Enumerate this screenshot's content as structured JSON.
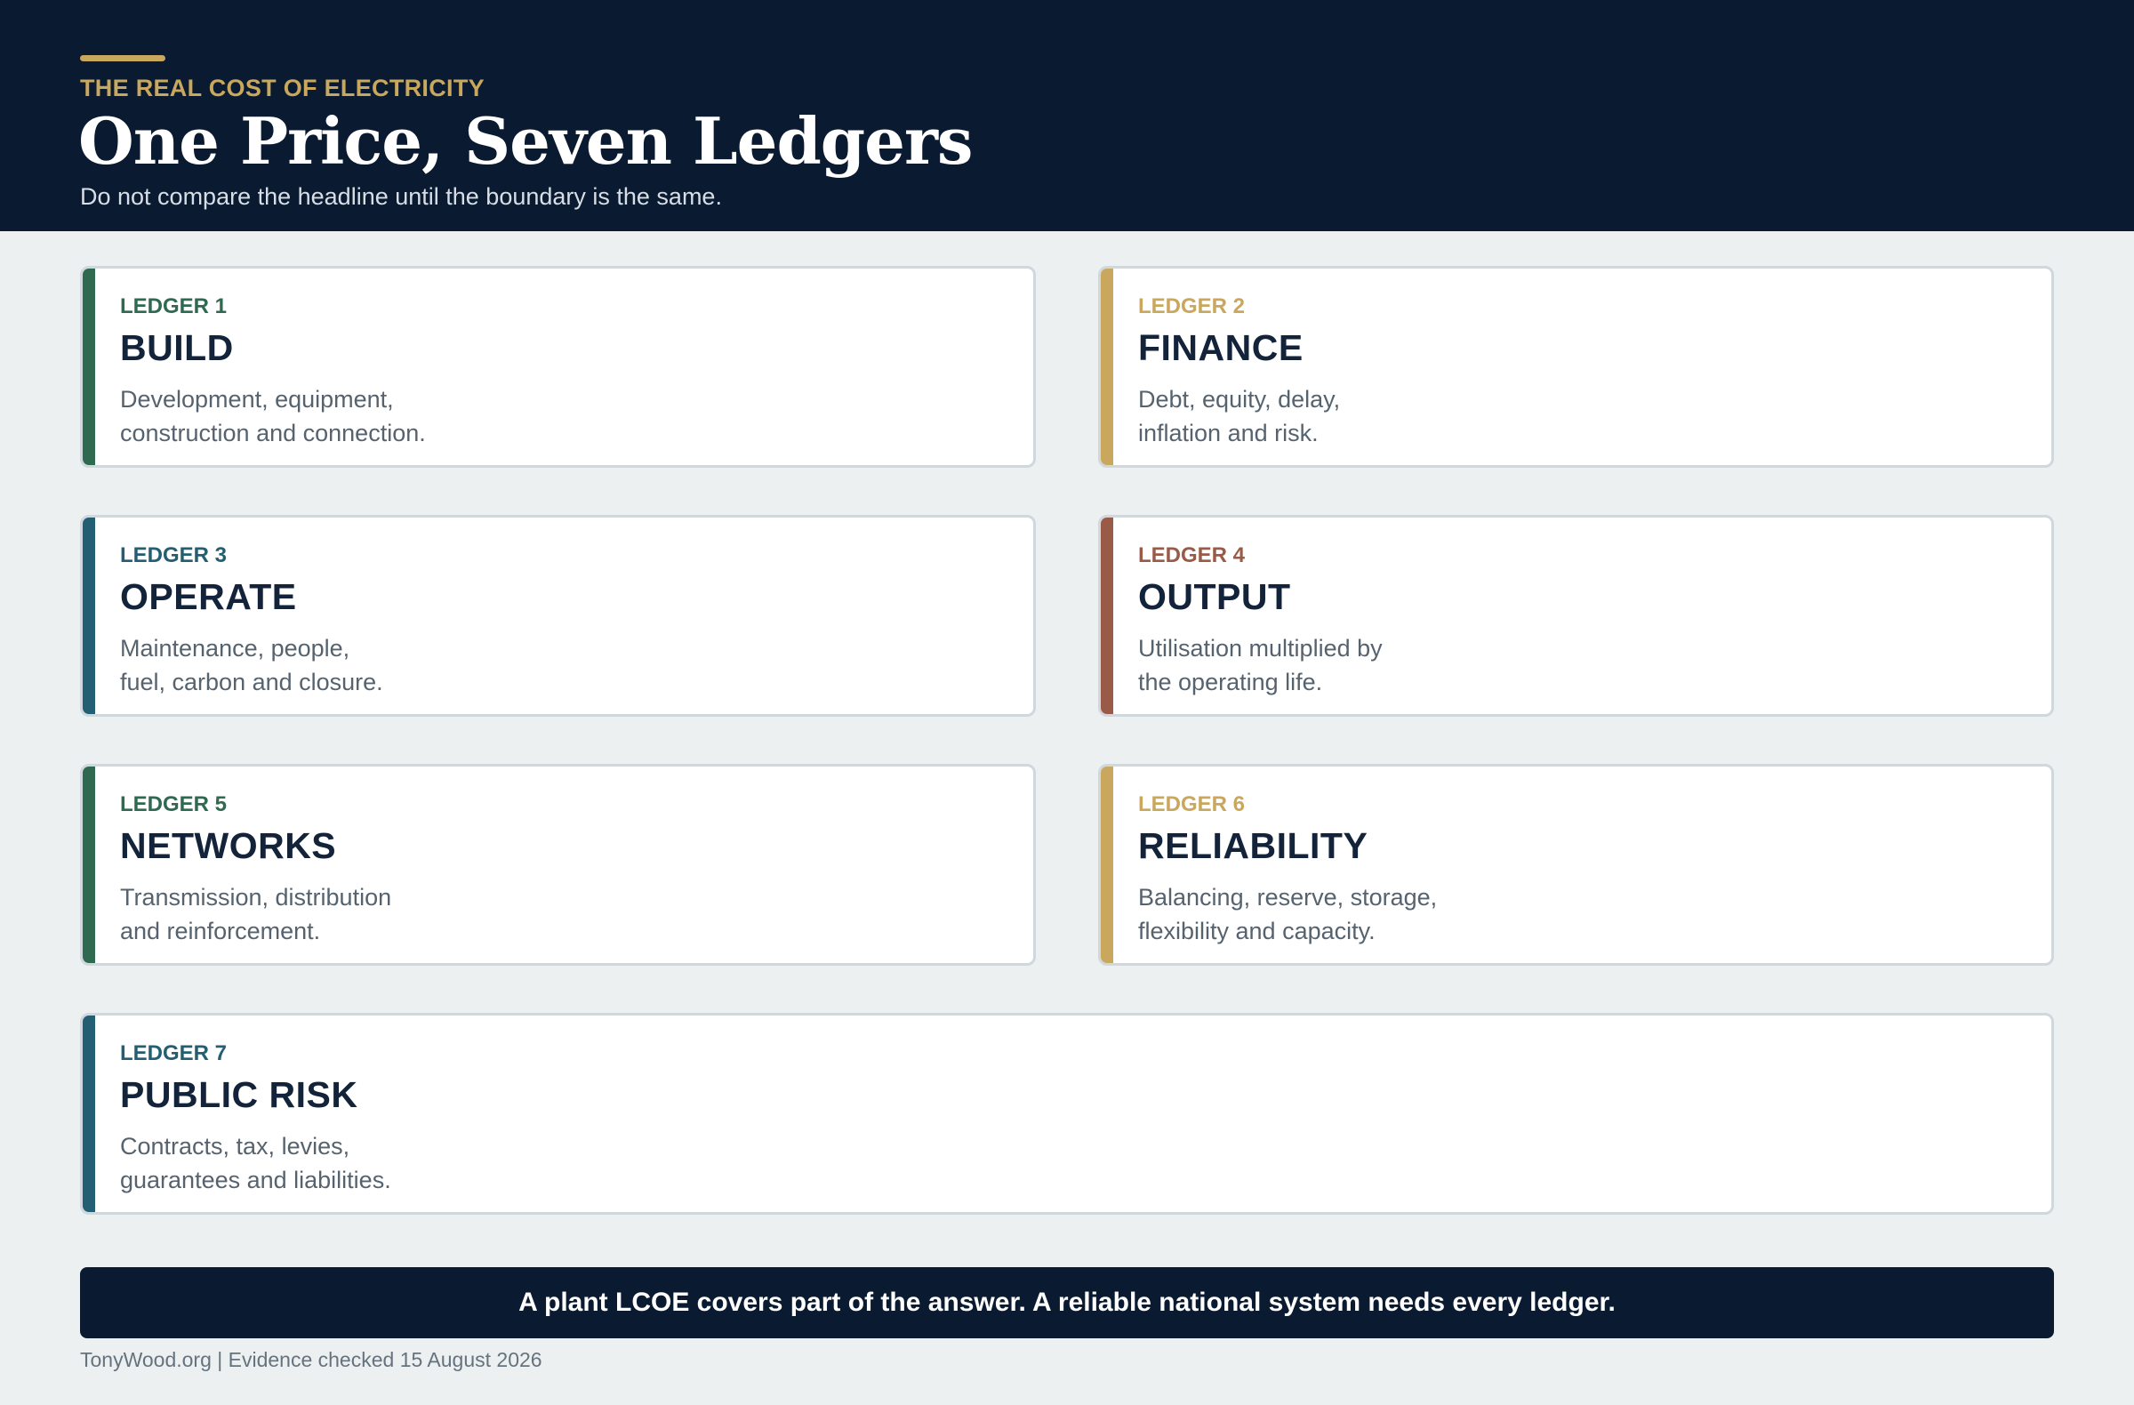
{
  "header": {
    "kicker": "THE REAL COST OF ELECTRICITY",
    "title": "One Price, Seven Ledgers",
    "subtitle": "Do not compare the headline until the boundary is the same."
  },
  "colors": {
    "navy": "#0a1b31",
    "green": "#2f6a50",
    "gold": "#c9a75c",
    "teal": "#245e73",
    "rust": "#9a5a48"
  },
  "ledgers": [
    {
      "label": "LEDGER 1",
      "name": "BUILD",
      "desc": [
        "Development, equipment,",
        "construction and connection."
      ],
      "color": "#2f6a50"
    },
    {
      "label": "LEDGER 2",
      "name": "FINANCE",
      "desc": [
        "Debt, equity, delay,",
        "inflation and risk."
      ],
      "color": "#c9a75c"
    },
    {
      "label": "LEDGER 3",
      "name": "OPERATE",
      "desc": [
        "Maintenance, people,",
        "fuel, carbon and closure."
      ],
      "color": "#245e73"
    },
    {
      "label": "LEDGER 4",
      "name": "OUTPUT",
      "desc": [
        "Utilisation multiplied by",
        "the operating life."
      ],
      "color": "#9a5a48"
    },
    {
      "label": "LEDGER 5",
      "name": "NETWORKS",
      "desc": [
        "Transmission, distribution",
        "and reinforcement."
      ],
      "color": "#2f6a50"
    },
    {
      "label": "LEDGER 6",
      "name": "RELIABILITY",
      "desc": [
        "Balancing, reserve, storage,",
        "flexibility and capacity."
      ],
      "color": "#c9a75c"
    },
    {
      "label": "LEDGER 7",
      "name": "PUBLIC RISK",
      "desc": [
        "Contracts, tax, levies,",
        "guarantees and liabilities."
      ],
      "color": "#245e73"
    }
  ],
  "banner": "A plant LCOE covers part of the answer. A reliable national system needs every ledger.",
  "footer": "TonyWood.org | Evidence checked 15 August 2026"
}
